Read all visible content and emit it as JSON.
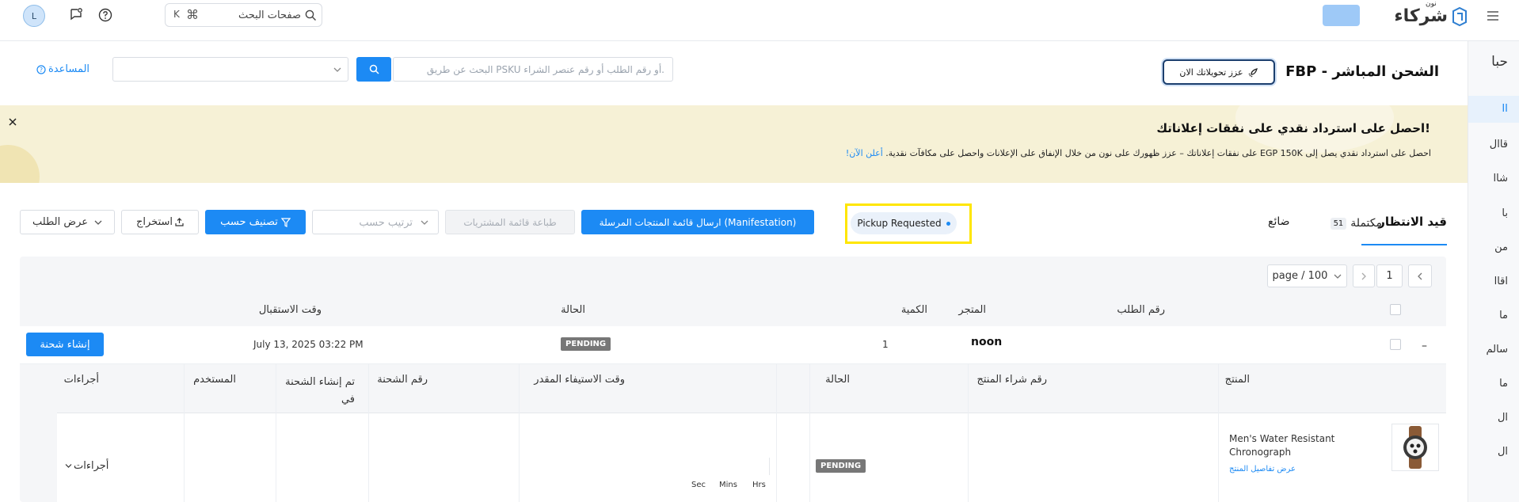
{
  "topbar": {
    "brand_small": "نون",
    "brand_name": "شركاء",
    "search_label": "صفحات البحث",
    "search_shortcut_key": "K",
    "search_shortcut_cmd": "⌘",
    "avatar_letter": "L"
  },
  "sidebar": {
    "items": [
      "حبا",
      "II",
      "قاال",
      "شاا",
      "با",
      "من",
      "اقاا",
      "ما",
      "سالم",
      "ما",
      "ال",
      "ال"
    ]
  },
  "header": {
    "title": "FBP - الشحن المباشر",
    "boost_label": "عزز تحويلاتك الان",
    "search_placeholder": "البحث عن طريق PSKU أو رقم الطلب أو رقم عنصر الشراء.",
    "help_label": "المساعدة"
  },
  "banner": {
    "title": "احصل على استرداد نقدي على نفقات إعلاناتك!",
    "body": "احصل على استرداد نقدي يصل إلى EGP 150K على نفقات إعلاناتك – عزز ظهورك على نون من خلال الإنفاق على الإعلانات واحصل على مكافآت نقدية.",
    "link": "أعلن الآن!",
    "bg_color": "#f6f1d6"
  },
  "tabs": {
    "pending_label": "قيد الانتظار",
    "completed_count": "51",
    "completed_label": "مكتملة",
    "lost_label": "ضائع",
    "status_chip": "Pickup Requested"
  },
  "toolbar": {
    "manifest_label": "ارسال قائمة المنتجات المرسلة (Manifestation)",
    "print_label": "طباعة قائمة المشتريات",
    "sort_placeholder": "ترتيب حسب",
    "filter_label": "تصنيف حسب",
    "export_label": "استخراج",
    "view_label": "عرض الطلب"
  },
  "pagination": {
    "page": "1",
    "page_size": "page / 100"
  },
  "orders_table": {
    "headers": {
      "order_no": "رقم الطلب",
      "store": "المتجر",
      "qty": "الكمية",
      "status": "الحالة",
      "received_time": "وقت الاستقبال"
    },
    "row": {
      "store_logo": "noon",
      "qty": "1",
      "status": "PENDING",
      "received_time": "July 13, 2025 03:22 PM",
      "create_shipment_label": "إنشاء شحنة"
    }
  },
  "items_table": {
    "headers": {
      "product": "المنتج",
      "purchase_no": "رقم شراء المنتج",
      "status": "الحالة",
      "est_fulfill": "وقت الاستيفاء المقدر",
      "shipment_no": "رقم الشحنة",
      "created_in": "تم إنشاء الشحنة في",
      "user": "المستخدم",
      "actions": "أجراءات"
    },
    "row": {
      "product_name": "Men's Water Resistant Chronograph",
      "product_link": "عرض تفاصيل المنتج",
      "status": "PENDING",
      "time_units": [
        "Sec",
        "Mins",
        "Hrs"
      ],
      "actions_label": "أجراءات"
    }
  },
  "colors": {
    "primary": "#1c8af4",
    "highlight": "#ffe600",
    "badge": "#777777"
  }
}
